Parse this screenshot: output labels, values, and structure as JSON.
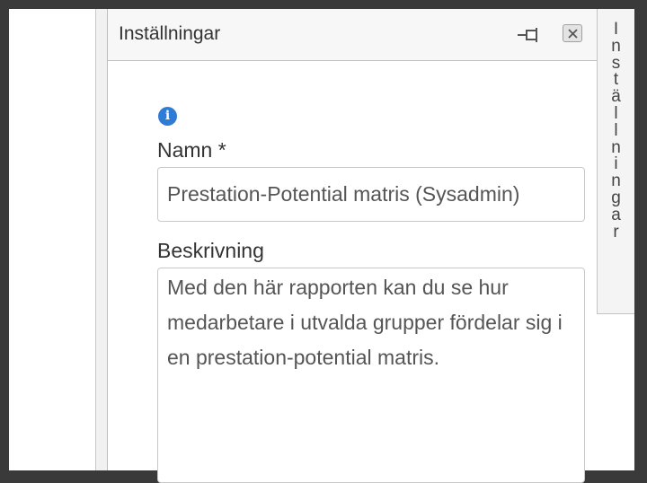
{
  "panel": {
    "title": "Inställningar",
    "pin_icon": "pin-icon",
    "close_icon": "close-icon"
  },
  "form": {
    "info_icon": "info-icon",
    "name_label": "Namn *",
    "name_value": "Prestation-Potential matris (Sysadmin)",
    "description_label": "Beskrivning",
    "description_value": "Med den här rapporten kan du se hur medarbetare i utvalda grupper fördelar sig i en prestation-potential matris."
  },
  "side_tab": {
    "letters": [
      "I",
      "n",
      "s",
      "t",
      "ä",
      "l",
      "l",
      "n",
      "i",
      "n",
      "g",
      "a",
      "r"
    ]
  },
  "colors": {
    "info_blue": "#2f7cd6",
    "header_bg": "#f7f7f7",
    "frame_dark": "#3a3a3a"
  }
}
